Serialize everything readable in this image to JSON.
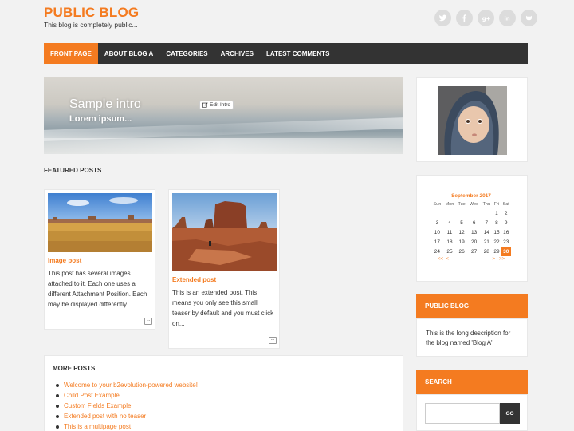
{
  "site": {
    "title": "PUBLIC BLOG",
    "tagline": "This blog is completely public..."
  },
  "social": [
    "twitter-icon",
    "facebook-icon",
    "googleplus-icon",
    "linkedin-icon",
    "github-icon"
  ],
  "nav": {
    "items": [
      {
        "label": "FRONT PAGE",
        "active": true
      },
      {
        "label": "ABOUT BLOG A"
      },
      {
        "label": "CATEGORIES"
      },
      {
        "label": "ARCHIVES"
      },
      {
        "label": "LATEST COMMENTS"
      }
    ]
  },
  "intro": {
    "title": "Sample intro",
    "subtitle": "Lorem ipsum...",
    "edit_label": "Edit Intro"
  },
  "featured": {
    "heading": "FEATURED POSTS",
    "posts": [
      {
        "title": "Image post",
        "excerpt": "This post has several images attached to it. Each one uses a different Attachment Position. Each may be displayed differently...",
        "more": "..."
      },
      {
        "title": "Extended post",
        "excerpt": "This is an extended post. This means you only see this small teaser by default and you must click on...",
        "more": "..."
      }
    ]
  },
  "more_posts": {
    "heading": "MORE POSTS",
    "items": [
      "Welcome to your b2evolution-powered website!",
      "Child Post Example",
      "Custom Fields Example",
      "Extended post with no teaser",
      "This is a multipage post"
    ]
  },
  "calendar": {
    "caption": "September 2017",
    "weekdays": [
      "Sun",
      "Mon",
      "Tue",
      "Wed",
      "Thu",
      "Fri",
      "Sat"
    ],
    "weeks": [
      [
        "",
        "",
        "",
        "",
        "",
        "1",
        "2"
      ],
      [
        "3",
        "4",
        "5",
        "6",
        "7",
        "8",
        "9"
      ],
      [
        "10",
        "11",
        "12",
        "13",
        "14",
        "15",
        "16"
      ],
      [
        "17",
        "18",
        "19",
        "20",
        "21",
        "22",
        "23"
      ],
      [
        "24",
        "25",
        "26",
        "27",
        "28",
        "29",
        "30"
      ]
    ],
    "today": "30",
    "prev_year": "<<",
    "prev_month": "<",
    "next_month": ">",
    "next_year": ">>"
  },
  "blog_widget": {
    "heading": "PUBLIC BLOG",
    "text": "This is the long description for the blog named 'Blog A'."
  },
  "search": {
    "heading": "SEARCH",
    "button": "GO",
    "value": ""
  },
  "colors": {
    "accent": "#f47b20",
    "nav_bg": "#333333",
    "page_bg": "#f2f2f2"
  }
}
